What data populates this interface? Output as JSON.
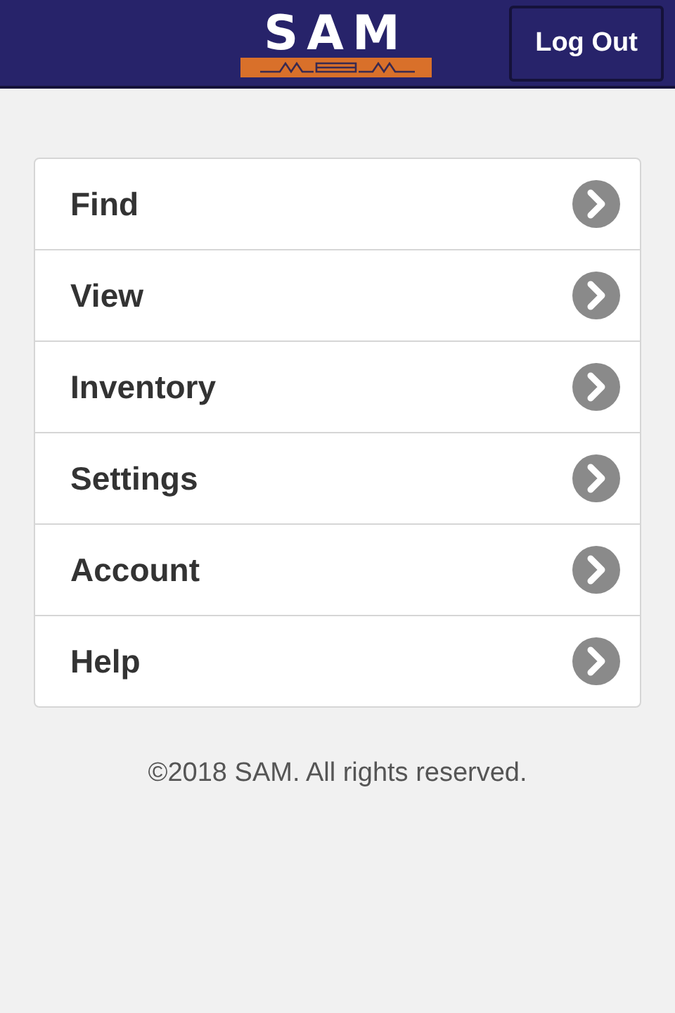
{
  "header": {
    "logo": "SAM",
    "logout": "Log Out"
  },
  "menu": [
    {
      "label": "Find"
    },
    {
      "label": "View"
    },
    {
      "label": "Inventory"
    },
    {
      "label": "Settings"
    },
    {
      "label": "Account"
    },
    {
      "label": "Help"
    }
  ],
  "footer": "©2018 SAM. All rights reserved."
}
